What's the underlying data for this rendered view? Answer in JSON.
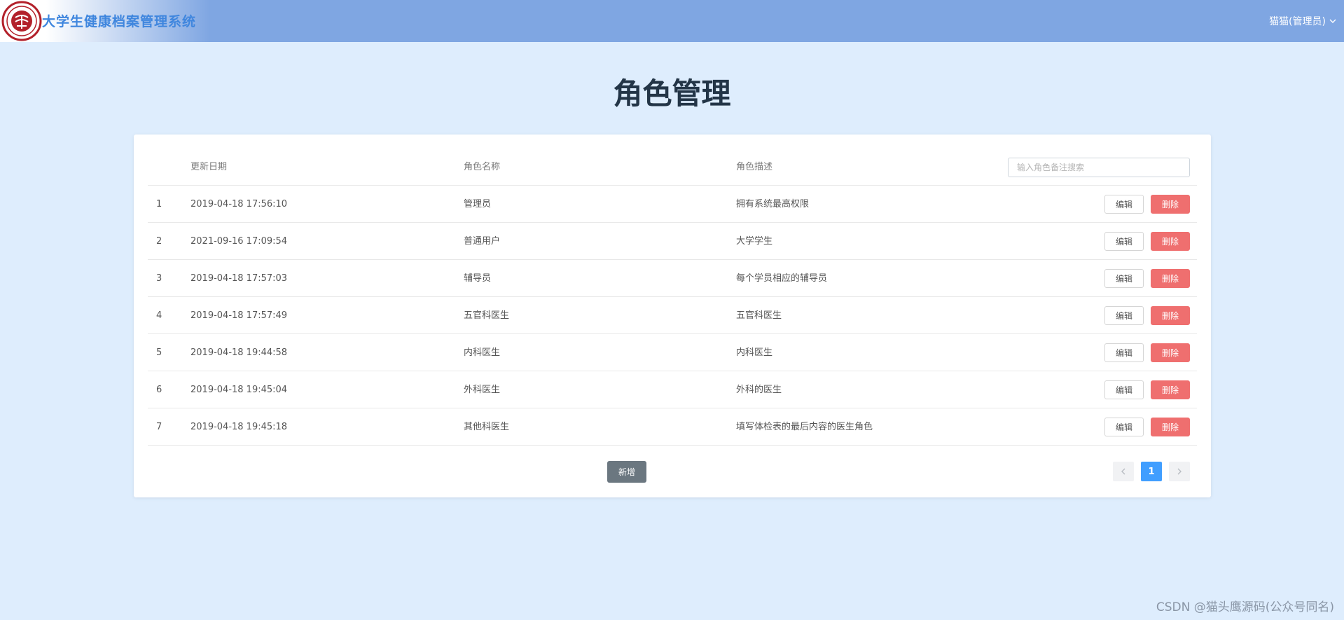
{
  "header": {
    "app_title": "大学生健康档案管理系统",
    "user_label": "猫猫(管理员)",
    "logo_icon": "university-seal-logo",
    "colors": {
      "topbar": "#7fa6e2",
      "title": "#3f86de"
    }
  },
  "page": {
    "title": "角色管理"
  },
  "table": {
    "headers": {
      "date": "更新日期",
      "name": "角色名称",
      "desc": "角色描述"
    },
    "search_placeholder": "输入角色备注搜索",
    "edit_label": "编辑",
    "delete_label": "删除",
    "rows": [
      {
        "idx": "1",
        "date": "2019-04-18 17:56:10",
        "name": "管理员",
        "desc": "拥有系统最高权限"
      },
      {
        "idx": "2",
        "date": "2021-09-16 17:09:54",
        "name": "普通用户",
        "desc": "大学学生"
      },
      {
        "idx": "3",
        "date": "2019-04-18 17:57:03",
        "name": "辅导员",
        "desc": "每个学员相应的辅导员"
      },
      {
        "idx": "4",
        "date": "2019-04-18 17:57:49",
        "name": "五官科医生",
        "desc": "五官科医生"
      },
      {
        "idx": "5",
        "date": "2019-04-18 19:44:58",
        "name": "内科医生",
        "desc": "内科医生"
      },
      {
        "idx": "6",
        "date": "2019-04-18 19:45:04",
        "name": "外科医生",
        "desc": "外科的医生"
      },
      {
        "idx": "7",
        "date": "2019-04-18 19:45:18",
        "name": "其他科医生",
        "desc": "填写体检表的最后内容的医生角色"
      }
    ]
  },
  "actions": {
    "add_label": "新增"
  },
  "pagination": {
    "current": "1"
  },
  "watermark": "CSDN @猫头鹰源码(公众号同名)",
  "colors": {
    "delete": "#ef6f6f",
    "page_active": "#409eff",
    "add_button": "#6b7780",
    "background": "#deedfd"
  }
}
